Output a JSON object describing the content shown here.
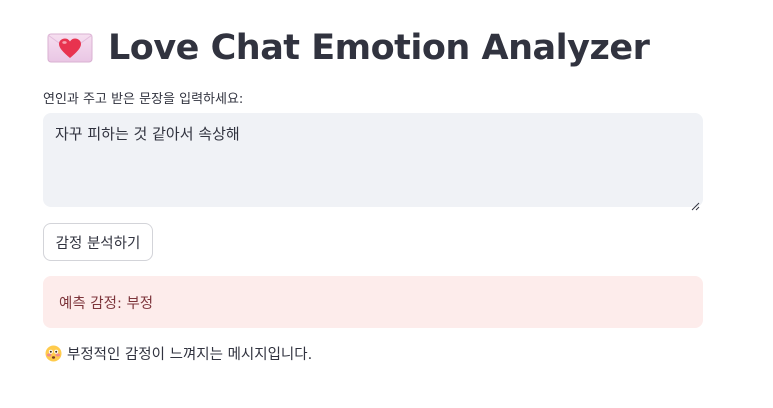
{
  "header": {
    "icon": "love-letter-icon",
    "title": "Love Chat Emotion Analyzer"
  },
  "form": {
    "label": "연인과 주고 받은 문장을 입력하세요:",
    "input_value": "자꾸 피하는 것 같아서 속상해",
    "button_label": "감정 분석하기"
  },
  "result": {
    "prediction_text": "예측 감정: 부정",
    "message_icon": "flushed-face-icon",
    "message_text": "부정적인 감정이 느껴지는 메시지입니다."
  },
  "colors": {
    "input_bg": "#f0f2f6",
    "error_bg": "#fdeceb",
    "error_text": "#7d353b",
    "text": "#31333f"
  }
}
